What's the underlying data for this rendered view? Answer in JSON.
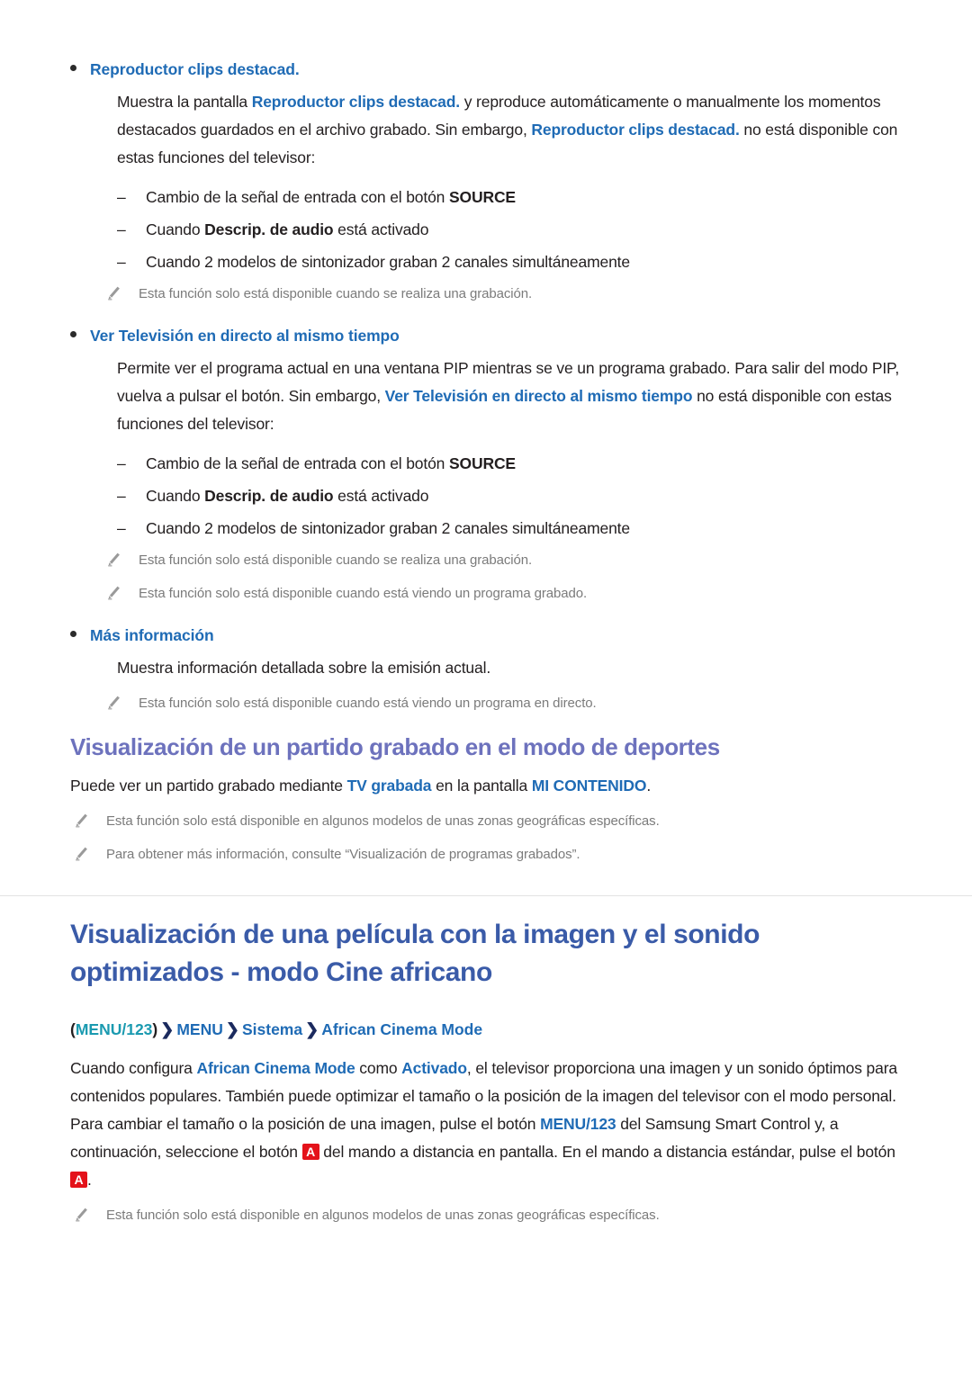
{
  "section_recorded_playback": {
    "items": [
      {
        "bullet_label": "Reproductor clips destacad.",
        "paragraph_parts": [
          {
            "t": "Muestra la pantalla ",
            "b": false
          },
          {
            "t": "Reproductor clips destacad.",
            "b": true
          },
          {
            "t": " y reproduce automáticamente o manualmente los momentos destacados guardados en el archivo grabado. Sin embargo, ",
            "b": false
          },
          {
            "t": "Reproductor clips destacad.",
            "b": true
          },
          {
            "t": " no está disponible con estas funciones del televisor:",
            "b": false
          }
        ],
        "dashes": [
          [
            {
              "t": "Cambio de la señal de entrada con el botón ",
              "b": false
            },
            {
              "t": "SOURCE",
              "b": true
            }
          ],
          [
            {
              "t": "Cuando ",
              "b": false
            },
            {
              "t": "Descrip. de audio",
              "b": true
            },
            {
              "t": " está activado",
              "b": false
            }
          ],
          [
            {
              "t": "Cuando 2 modelos de sintonizador graban 2 canales simultáneamente",
              "b": false
            }
          ]
        ],
        "notes": [
          "Esta función solo está disponible cuando se realiza una grabación."
        ]
      },
      {
        "bullet_label": "Ver Televisión en directo al mismo tiempo",
        "paragraph_parts": [
          {
            "t": "Permite ver el programa actual en una ventana PIP mientras se ve un programa grabado. Para salir del modo PIP, vuelva a pulsar el botón. Sin embargo, ",
            "b": false
          },
          {
            "t": "Ver Televisión en directo al mismo tiempo",
            "b": true
          },
          {
            "t": " no está disponible con estas funciones del televisor:",
            "b": false
          }
        ],
        "dashes": [
          [
            {
              "t": "Cambio de la señal de entrada con el botón ",
              "b": false
            },
            {
              "t": "SOURCE",
              "b": true
            }
          ],
          [
            {
              "t": "Cuando ",
              "b": false
            },
            {
              "t": "Descrip. de audio",
              "b": true
            },
            {
              "t": " está activado",
              "b": false
            }
          ],
          [
            {
              "t": "Cuando 2 modelos de sintonizador graban 2 canales simultáneamente",
              "b": false
            }
          ]
        ],
        "notes": [
          "Esta función solo está disponible cuando se realiza una grabación.",
          "Esta función solo está disponible cuando está viendo un programa grabado."
        ]
      },
      {
        "bullet_label": "Más información",
        "paragraph_parts": [
          {
            "t": "Muestra información detallada sobre la emisión actual.",
            "b": false
          }
        ],
        "dashes": [],
        "notes": [
          "Esta función solo está disponible cuando está viendo un programa en directo."
        ]
      }
    ]
  },
  "section_sports": {
    "heading": "Visualización de un partido grabado en el modo de deportes",
    "paragraph_parts": [
      {
        "t": "Puede ver un partido grabado mediante ",
        "b": false
      },
      {
        "t": "TV grabada",
        "b": true
      },
      {
        "t": " en la pantalla ",
        "b": false
      },
      {
        "t": "MI CONTENIDO",
        "b": true
      },
      {
        "t": ".",
        "b": false
      }
    ],
    "notes": [
      "Esta función solo está disponible en algunos modelos de unas zonas geográficas específicas.",
      "Para obtener más información, consulte “Visualización de programas grabados”."
    ]
  },
  "section_african_cinema": {
    "heading_line_1": "Visualización de una película con la imagen y el sonido",
    "heading_line_2": "optimizados - modo Cine africano",
    "breadcrumb": {
      "open_paren": "(",
      "menu123": "MENU/123",
      "close_paren": ")",
      "arrow": "❯",
      "items": [
        "MENU",
        "Sistema",
        "African Cinema Mode"
      ]
    },
    "paragraph_parts": [
      {
        "t": "Cuando configura ",
        "b": false
      },
      {
        "t": "African Cinema Mode",
        "b": true
      },
      {
        "t": " como ",
        "b": false
      },
      {
        "t": "Activado",
        "b": true
      },
      {
        "t": ", el televisor proporciona una imagen y un sonido óptimos para contenidos populares. También puede optimizar el tamaño o la posición de la imagen del televisor con el modo personal. Para cambiar el tamaño o la posición de una imagen, pulse el botón ",
        "b": false
      },
      {
        "t": "MENU/123",
        "b": true
      },
      {
        "t": " del Samsung Smart Control y, a continuación, seleccione el botón ",
        "b": false
      },
      {
        "t": "A",
        "b": false,
        "key": true
      },
      {
        "t": " del mando a distancia en pantalla. En el mando a distancia estándar, pulse el botón ",
        "b": false
      },
      {
        "t": "A",
        "b": false,
        "key": true
      },
      {
        "t": ".",
        "b": false
      }
    ],
    "notes": [
      "Esta función solo está disponible en algunos modelos de unas zonas geográficas específicas."
    ]
  },
  "icons": {
    "note": "pencil-icon",
    "bullet": "bullet-dot-icon",
    "dash": "dash-icon",
    "arrow": "chevron-right-icon"
  },
  "colors": {
    "link_blue": "#1f6bb5",
    "heading_purple": "#6d72bd",
    "heading_blue": "#3a5ba8",
    "teal": "#1a9ab0",
    "note_gray": "#7b7b7b",
    "key_red": "#e4121a",
    "body": "#231f20"
  }
}
